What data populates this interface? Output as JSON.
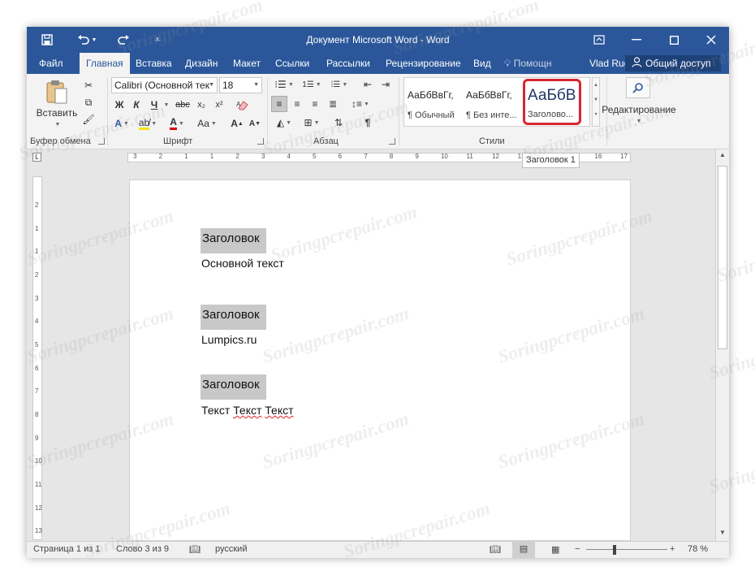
{
  "window": {
    "title": "Документ Microsoft Word - Word",
    "controls": [
      "ribbon-display-options",
      "minimize",
      "maximize",
      "close"
    ]
  },
  "quick_access": {
    "save_icon": "save-icon",
    "undo_icon": "undo-icon",
    "redo_icon": "redo-icon",
    "customize_icon": "customize-qat-icon"
  },
  "tabs": [
    "Файл",
    "Главная",
    "Вставка",
    "Дизайн",
    "Макет",
    "Ссылки",
    "Рассылки",
    "Рецензирование",
    "Вид"
  ],
  "active_tab": "Главная",
  "tell_me": "Помощн",
  "user": "Vlad Ruga...",
  "share": "Общий доступ",
  "ribbon": {
    "clipboard": {
      "label": "Буфер обмена",
      "paste": "Вставить"
    },
    "font": {
      "label": "Шрифт",
      "font_name": "Calibri (Основной тек",
      "font_size": "18",
      "bold": "Ж",
      "italic": "К",
      "underline": "Ч",
      "strike": "abc",
      "subscript": "x₂",
      "superscript": "x²",
      "change_case": "Aa",
      "grow": "A",
      "shrink": "A",
      "font_color": "A"
    },
    "paragraph": {
      "label": "Абзац"
    },
    "styles": {
      "label": "Стили",
      "items": [
        {
          "sample": "АаБбВвГг,",
          "name": "¶ Обычный"
        },
        {
          "sample": "АаБбВвГг,",
          "name": "¶ Без инте..."
        },
        {
          "sample": "АаБбВ",
          "name": "Заголово..."
        }
      ],
      "selected_index": 2,
      "highlight_color": "#d7262f"
    },
    "editing": {
      "label": "Редактирование"
    }
  },
  "tooltip": "Заголовок 1",
  "ruler": {
    "h_numbers": [
      "3",
      "2",
      "1",
      "1",
      "2",
      "3",
      "4",
      "5",
      "6",
      "7",
      "8",
      "9",
      "10",
      "11",
      "12",
      "13",
      "14",
      "15",
      "16",
      "17"
    ],
    "v_numbers": [
      "2",
      "1",
      "1",
      "2",
      "3",
      "4",
      "5",
      "6",
      "7",
      "8",
      "9",
      "10",
      "11",
      "12",
      "13"
    ]
  },
  "document": {
    "blocks": [
      {
        "heading": "Заголовок",
        "body": "Основной текст"
      },
      {
        "heading": "Заголовок",
        "body": "Lumpics.ru"
      },
      {
        "heading": "Заголовок",
        "body_words": [
          "Текст",
          "Текст",
          "Текст"
        ]
      }
    ]
  },
  "status": {
    "page": "Страница 1 из 1",
    "words": "Слово 3 из 9",
    "language": "русский",
    "zoom": "78 %",
    "zoom_minus": "−",
    "zoom_plus": "+"
  },
  "watermark": "Soringpcrepair.com",
  "colors": {
    "titlebar": "#2b579a",
    "ribbon": "#f3f3f3",
    "heading_bg": "#c8c8c8",
    "highlight": "#d7262f"
  }
}
